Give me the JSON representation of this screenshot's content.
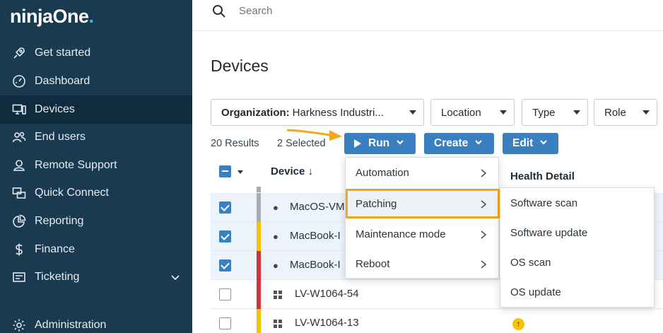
{
  "app": {
    "logo_main": "ninjaOne",
    "logo_dot": "."
  },
  "sidebar": {
    "items": [
      {
        "label": "Get started",
        "icon": "rocket-icon"
      },
      {
        "label": "Dashboard",
        "icon": "dashboard-icon"
      },
      {
        "label": "Devices",
        "icon": "devices-icon",
        "active": true
      },
      {
        "label": "End users",
        "icon": "users-icon"
      },
      {
        "label": "Remote Support",
        "icon": "remote-support-icon"
      },
      {
        "label": "Quick Connect",
        "icon": "quick-connect-icon"
      },
      {
        "label": "Reporting",
        "icon": "reporting-icon"
      },
      {
        "label": "Finance",
        "icon": "dollar-icon"
      },
      {
        "label": "Ticketing",
        "icon": "ticketing-icon",
        "expandable": true
      },
      {
        "label": "Administration",
        "icon": "gear-icon"
      }
    ]
  },
  "search": {
    "placeholder": "Search"
  },
  "page": {
    "title": "Devices"
  },
  "filters": {
    "organization_label": "Organization:",
    "organization_value": "Harkness Industri...",
    "location": "Location",
    "type": "Type",
    "role": "Role"
  },
  "toolbar": {
    "results": "20 Results",
    "selected": "2 Selected",
    "run": "Run",
    "create": "Create",
    "edit": "Edit"
  },
  "table": {
    "col_device": "Device ↓",
    "col_health": "Health Detail",
    "rows": [
      {
        "name": "MacOS-VM",
        "os": "mac",
        "checked": true,
        "status": "#a7adb3"
      },
      {
        "name": "MacBook-I",
        "os": "mac",
        "checked": true,
        "status": "#f5c400"
      },
      {
        "name": "MacBook-I",
        "os": "mac",
        "checked": true,
        "status": "#d0333a"
      },
      {
        "name": "LV-W1064-54",
        "os": "windows",
        "checked": false,
        "status": "#d0333a"
      },
      {
        "name": "LV-W1064-13",
        "os": "windows",
        "checked": false,
        "status": "#f5c400",
        "health": "warning"
      }
    ]
  },
  "run_menu": {
    "items": [
      "Automation",
      "Patching",
      "Maintenance mode",
      "Reboot"
    ],
    "highlighted": "Patching"
  },
  "patching_submenu": {
    "items": [
      "Software scan",
      "Software update",
      "OS scan",
      "OS update"
    ]
  },
  "colors": {
    "sidebar": "#1a3a4f",
    "accent": "#3a7fbf",
    "highlight": "#f2a81d"
  }
}
